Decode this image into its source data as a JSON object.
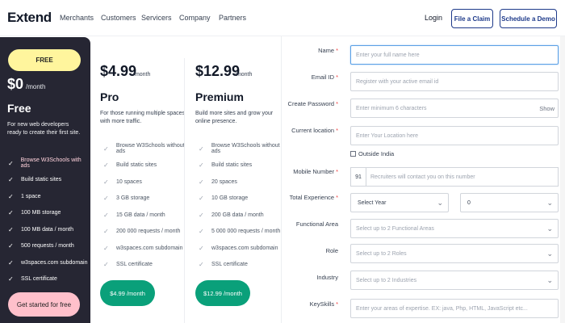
{
  "nav": {
    "brand": "Extend",
    "links": [
      "Merchants",
      "Customers",
      "Servicers",
      "Company",
      "Partners"
    ],
    "login": "Login",
    "file_claim": "File a Claim",
    "schedule_demo": "Schedule a Demo"
  },
  "free_plan": {
    "badge": "FREE",
    "price": "$0",
    "per": "/month",
    "title": "Free",
    "description": "For new web developers ready to create their first site.",
    "features": [
      "Browse W3Schools with ads",
      "Build static sites",
      "1 space",
      "100 MB storage",
      "100 MB data / month",
      "500 requests / month",
      "w3spaces.com subdomain",
      "SSL certificate"
    ],
    "cta": "Get started for free"
  },
  "pro_plan": {
    "price": "$4.99",
    "per": "/month",
    "title": "Pro",
    "description": "For those running multiple spaces with more traffic.",
    "features": [
      "Browse W3Schools without ads",
      "Build static sites",
      "10 spaces",
      "3 GB storage",
      "15 GB data / month",
      "200 000 requests / month",
      "w3spaces.com subdomain",
      "SSL certificate"
    ],
    "cta": "$4.99 /month"
  },
  "premium_plan": {
    "price": "$12.99",
    "per": "/month",
    "title": "Premium",
    "description": "Build more sites and grow your online presence.",
    "features": [
      "Browse W3Schools without ads",
      "Build static sites",
      "20 spaces",
      "10 GB storage",
      "200 GB data / month",
      "5 000 000 requests / month",
      "w3spaces.com subdomain",
      "SSL certificate"
    ],
    "cta": "$12.99 /month"
  },
  "form": {
    "name_label": "Name",
    "name_placeholder": "Enter your full name here",
    "email_label": "Email ID",
    "email_placeholder": "Register with your active email id",
    "password_label": "Create Password",
    "password_placeholder": "Enter minimum 6 characters",
    "password_show": "Show",
    "location_label": "Current location",
    "location_placeholder": "Enter Your Location here",
    "outside_india": "Outside India",
    "mobile_label": "Mobile Number",
    "mobile_code": "91",
    "mobile_placeholder": "Recruiters will contact you on this number",
    "experience_label": "Total Experience",
    "experience_year": "Select Year",
    "experience_month": "0",
    "functional_label": "Functional Area",
    "functional_placeholder": "Select up to 2 Functional Areas",
    "role_label": "Role",
    "role_placeholder": "Select up to 2 Roles",
    "industry_label": "Industry",
    "industry_placeholder": "Select up to 2 Industries",
    "keyskills_label": "KeySkills",
    "keyskills_placeholder": "Enter your areas of expertise. EX: java, Php, HTML, JavaScript etc...",
    "required_mark": "*"
  }
}
